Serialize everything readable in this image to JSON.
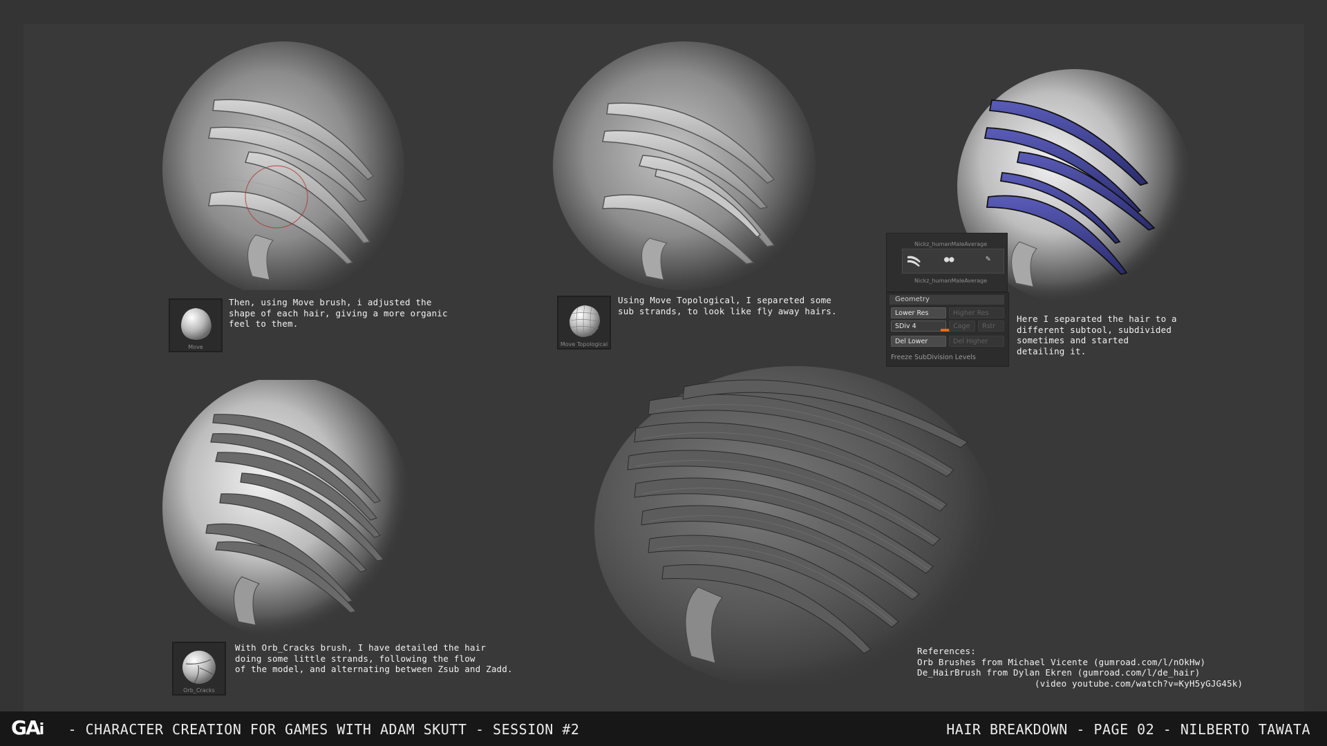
{
  "panels": {
    "step1": {
      "caption": "Then, using Move brush, i adjusted the\nshape of each hair, giving a more organic\nfeel to them.",
      "brush_label": "Move"
    },
    "step2": {
      "caption": "Using Move Topological, I separeted some\nsub strands, to look like fly away hairs.",
      "brush_label": "Move Topological"
    },
    "step3": {
      "caption": "Here I separated the hair to a\ndifferent subtool, subdivided\nsometimes and started\ndetailing it."
    },
    "step4": {
      "caption": "With Orb_Cracks brush, I have detailed the hair\ndoing some little strands, following the flow\nof the model, and alternating between Zsub and Zadd.",
      "brush_label": "Orb_Cracks"
    },
    "references": {
      "caption": "References:\nOrb Brushes from Michael Vicente (gumroad.com/l/nOkHw)\nDe_HairBrush from Dylan Ekren (gumroad.com/l/de_hair)\n                      (video youtube.com/watch?v=KyH5yGJG45k)"
    }
  },
  "zbrush_ui": {
    "subtool_name_top": "Nickz_humanMaleAverage",
    "subtool_name_bottom": "Nickz_humanMaleAverage",
    "geometry_title": "Geometry",
    "lower_res": "Lower Res",
    "higher_res": "Higher Res",
    "sdiv": "SDiv 4",
    "cage": "Cage",
    "rstr": "Rstr",
    "del_lower": "Del Lower",
    "del_higher": "Del Higher",
    "freeze": "Freeze SubDivision Levels",
    "slider_color": "#e86a1a"
  },
  "footer": {
    "logo_main": "GA",
    "logo_i": "i",
    "left_text": " - CHARACTER CREATION FOR GAMES WITH ADAM SKUTT - SESSION #2",
    "right_text": "HAIR BREAKDOWN - PAGE 02 - NILBERTO TAWATA"
  },
  "colors": {
    "background": "#343434",
    "footer": "#171717",
    "subtool_blue": "#3d3f8f"
  }
}
